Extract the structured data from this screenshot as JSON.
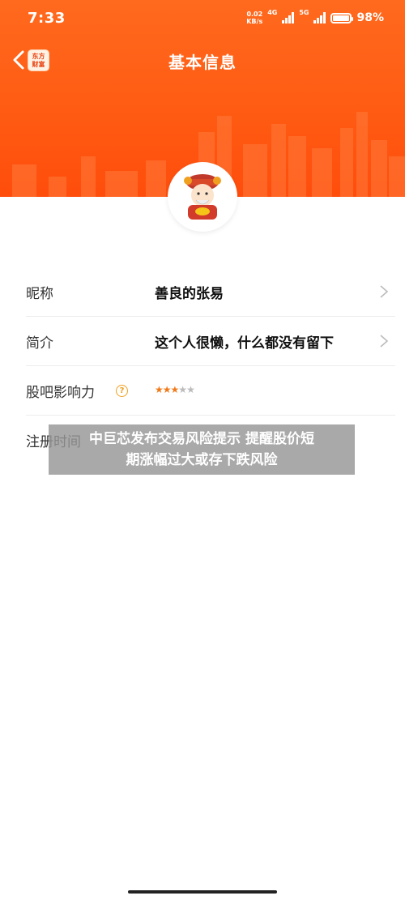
{
  "status_bar": {
    "time": "7:33",
    "net_speed_value": "0.02",
    "net_speed_unit": "KB/s",
    "network_1": "4G",
    "network_2": "5G",
    "battery": "98%"
  },
  "nav": {
    "title": "基本信息",
    "brand_line1": "东方",
    "brand_line2": "财富"
  },
  "profile": {
    "avatar_icon": "caishen-avatar-icon",
    "rows": [
      {
        "label": "昵称",
        "value": "善良的张易"
      },
      {
        "label": "简介",
        "value": "这个人很懒，什么都没有留下"
      },
      {
        "label": "股吧影响力",
        "help_icon": "?",
        "stars_filled": 3,
        "stars_total": 5
      },
      {
        "label": "注册时间",
        "value": ""
      }
    ]
  },
  "overlay": {
    "line1": "中巨芯发布交易风险提示 提醒股价短",
    "line2": "期涨幅过大或存下跌风险"
  },
  "colors": {
    "header": "#ff5a12",
    "star_on": "#f07a1a",
    "star_off": "#bbbbbb",
    "help": "#f0a020"
  }
}
